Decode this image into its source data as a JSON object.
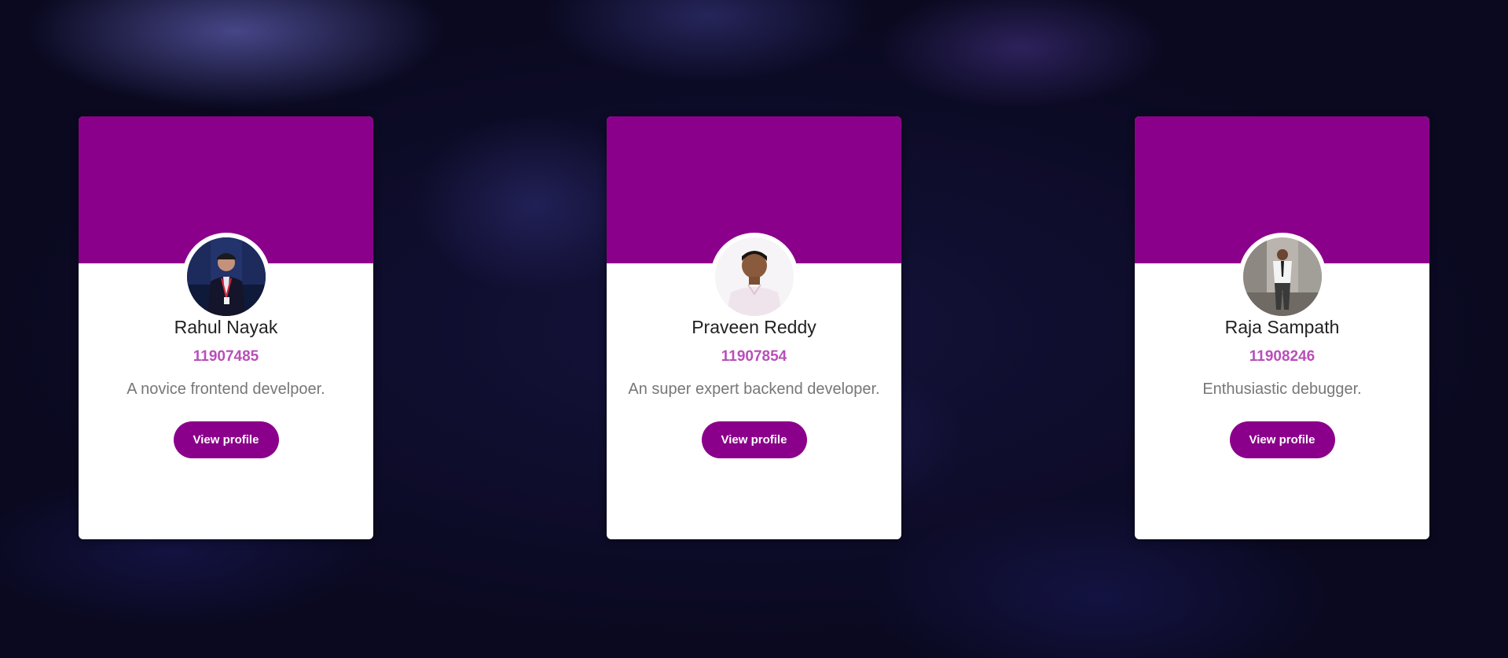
{
  "colors": {
    "accent": "#8b008b",
    "id_text": "#b84fb8",
    "card_bg": "#ffffff",
    "page_bg": "#0d0b24"
  },
  "cards": [
    {
      "name": "Rahul Nayak",
      "id": "11907485",
      "bio": "A novice frontend develpoer.",
      "button_label": "View profile",
      "avatar_icon": "profile-photo"
    },
    {
      "name": "Praveen Reddy",
      "id": "11907854",
      "bio": "An super expert backend developer.",
      "button_label": "View profile",
      "avatar_icon": "profile-photo"
    },
    {
      "name": "Raja Sampath",
      "id": "11908246",
      "bio": "Enthusiastic debugger.",
      "button_label": "View profile",
      "avatar_icon": "profile-photo"
    }
  ]
}
